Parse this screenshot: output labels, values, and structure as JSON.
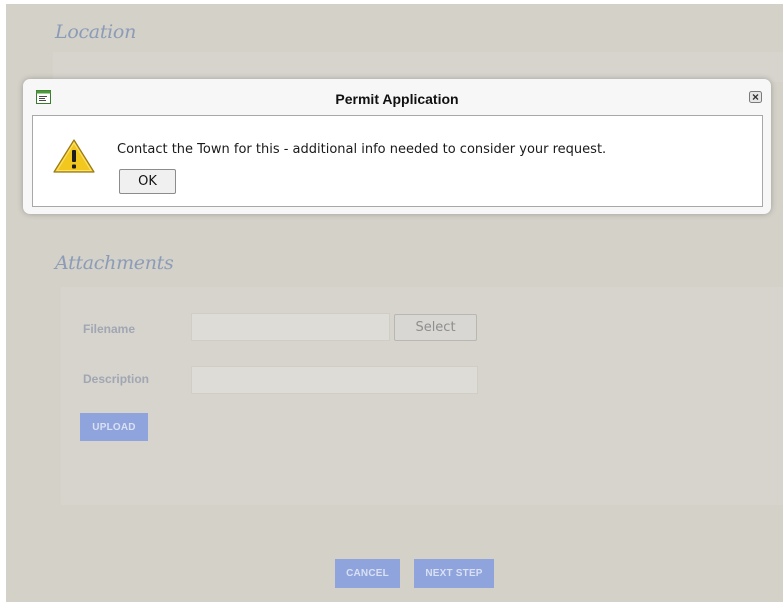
{
  "sections": {
    "location_title": "Location",
    "attachments_title": "Attachments"
  },
  "attachments": {
    "filename_label": "Filename",
    "filename_value": "",
    "select_label": "Select",
    "description_label": "Description",
    "description_value": "",
    "upload_label": "UPLOAD"
  },
  "footer": {
    "cancel_label": "CANCEL",
    "next_label": "NEXT STEP"
  },
  "dialog": {
    "title": "Permit Application",
    "message": "Contact the Town for this - additional info needed to consider your request.",
    "ok_label": "OK",
    "icons": {
      "title_icon": "window-app-icon",
      "close_icon": "close-icon",
      "message_icon": "warning-icon"
    }
  },
  "colors": {
    "page_bg": "#d3d1c8",
    "button_blue": "#8fa3dc",
    "section_title": "#8c9cb8",
    "warning_yellow": "#f2c81e"
  }
}
